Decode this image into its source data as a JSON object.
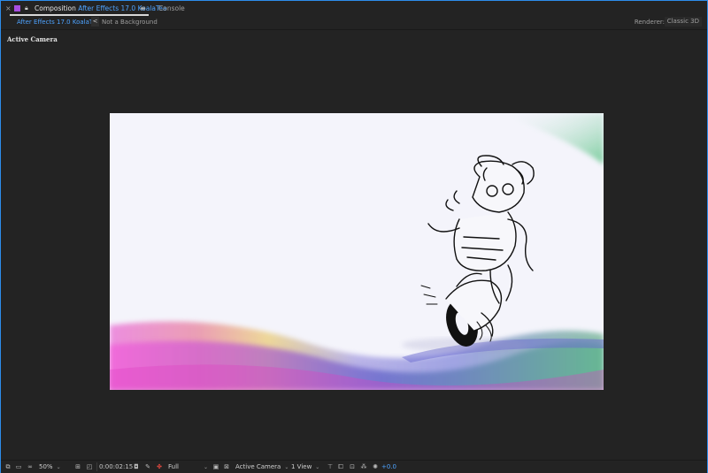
{
  "tabs": {
    "close_glyph": "×",
    "composition_prefix": "Composition",
    "composition_name": "After Effects 17.0 KoalaTea",
    "menu_glyph": "≡",
    "console": "Console"
  },
  "breadcrumbs": {
    "active": "After Effects 17.0 KoalaTea",
    "arrow_glyph": "<",
    "other": "Not a Background"
  },
  "renderer": {
    "label": "Renderer:",
    "value": "Classic 3D"
  },
  "viewer": {
    "label": "Active Camera"
  },
  "toolbar": {
    "zoom": "50%",
    "timecode": "0:00:02:15",
    "resolution": "Full",
    "camera": "Active Camera",
    "views": "1 View",
    "exposure": "+0.0",
    "chevron": "⌄"
  },
  "colors": {
    "accent": "#4ea3ff",
    "panel_bg": "#232323",
    "focus_border": "#2d8ceb",
    "comp_label": "#a64ee0"
  },
  "icons": [
    "close-icon",
    "composition-icon",
    "lock-icon",
    "panel-menu-icon",
    "always-preview-icon",
    "mask-visibility-icon",
    "magnification-icon",
    "grid-icon",
    "transparency-icon",
    "snapshot-icon",
    "show-channel-icon",
    "region-of-interest-icon",
    "toggle-transparency-grid-icon",
    "3d-view-icon",
    "layout-icon",
    "draft-3d-icon",
    "flowchart-icon",
    "fast-previews-icon",
    "reset-exposure-icon"
  ]
}
